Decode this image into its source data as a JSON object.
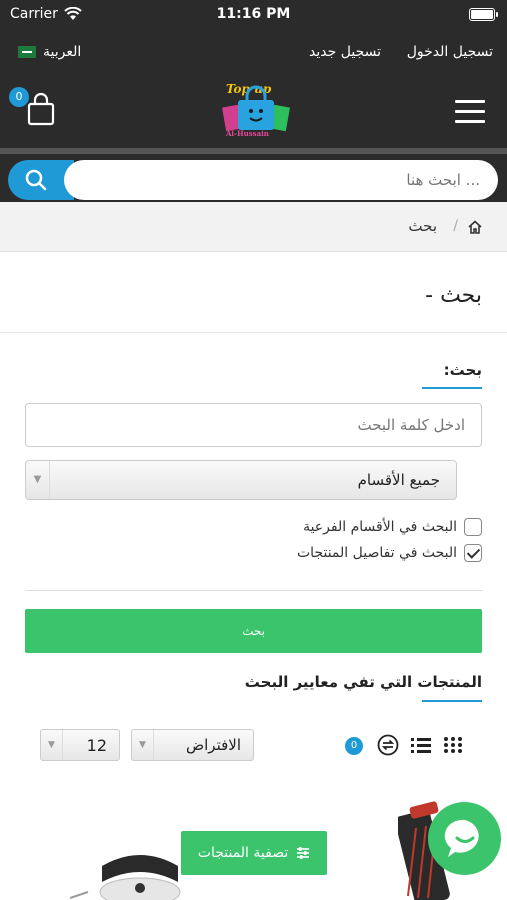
{
  "status_bar": {
    "carrier": "Carrier",
    "time": "11:16 PM"
  },
  "top_bar": {
    "language": "العربية",
    "register": "تسجيل جديد",
    "login": "تسجيل الدخول"
  },
  "header": {
    "cart_count": "0",
    "logo_top": "Top up",
    "logo_bottom": "Al-Hussain"
  },
  "search": {
    "placeholder": "... ابحث هنا"
  },
  "breadcrumb": {
    "current": "بحث",
    "separator": "/"
  },
  "page_title": "بحث -",
  "search_form": {
    "heading": "بحث:",
    "keyword_placeholder": "ادخل كلمة البحث",
    "category_selected": "جميع الأقسام",
    "option_subcategories": {
      "label": "البحث في الأقسام الفرعية",
      "checked": false
    },
    "option_descriptions": {
      "label": "البحث في تفاصيل المنتجات",
      "checked": true
    },
    "submit_label": "بحث"
  },
  "results": {
    "heading": "المنتجات التي تفي معايير البحث",
    "compare_count": "0",
    "sort_selected": "الافتراض",
    "limit_selected": "12",
    "filter_label": "تصفية المنتجات"
  },
  "colors": {
    "accent_blue": "#1f9ad6",
    "accent_green": "#3cc46c",
    "header_dark": "#2b2b2b"
  }
}
